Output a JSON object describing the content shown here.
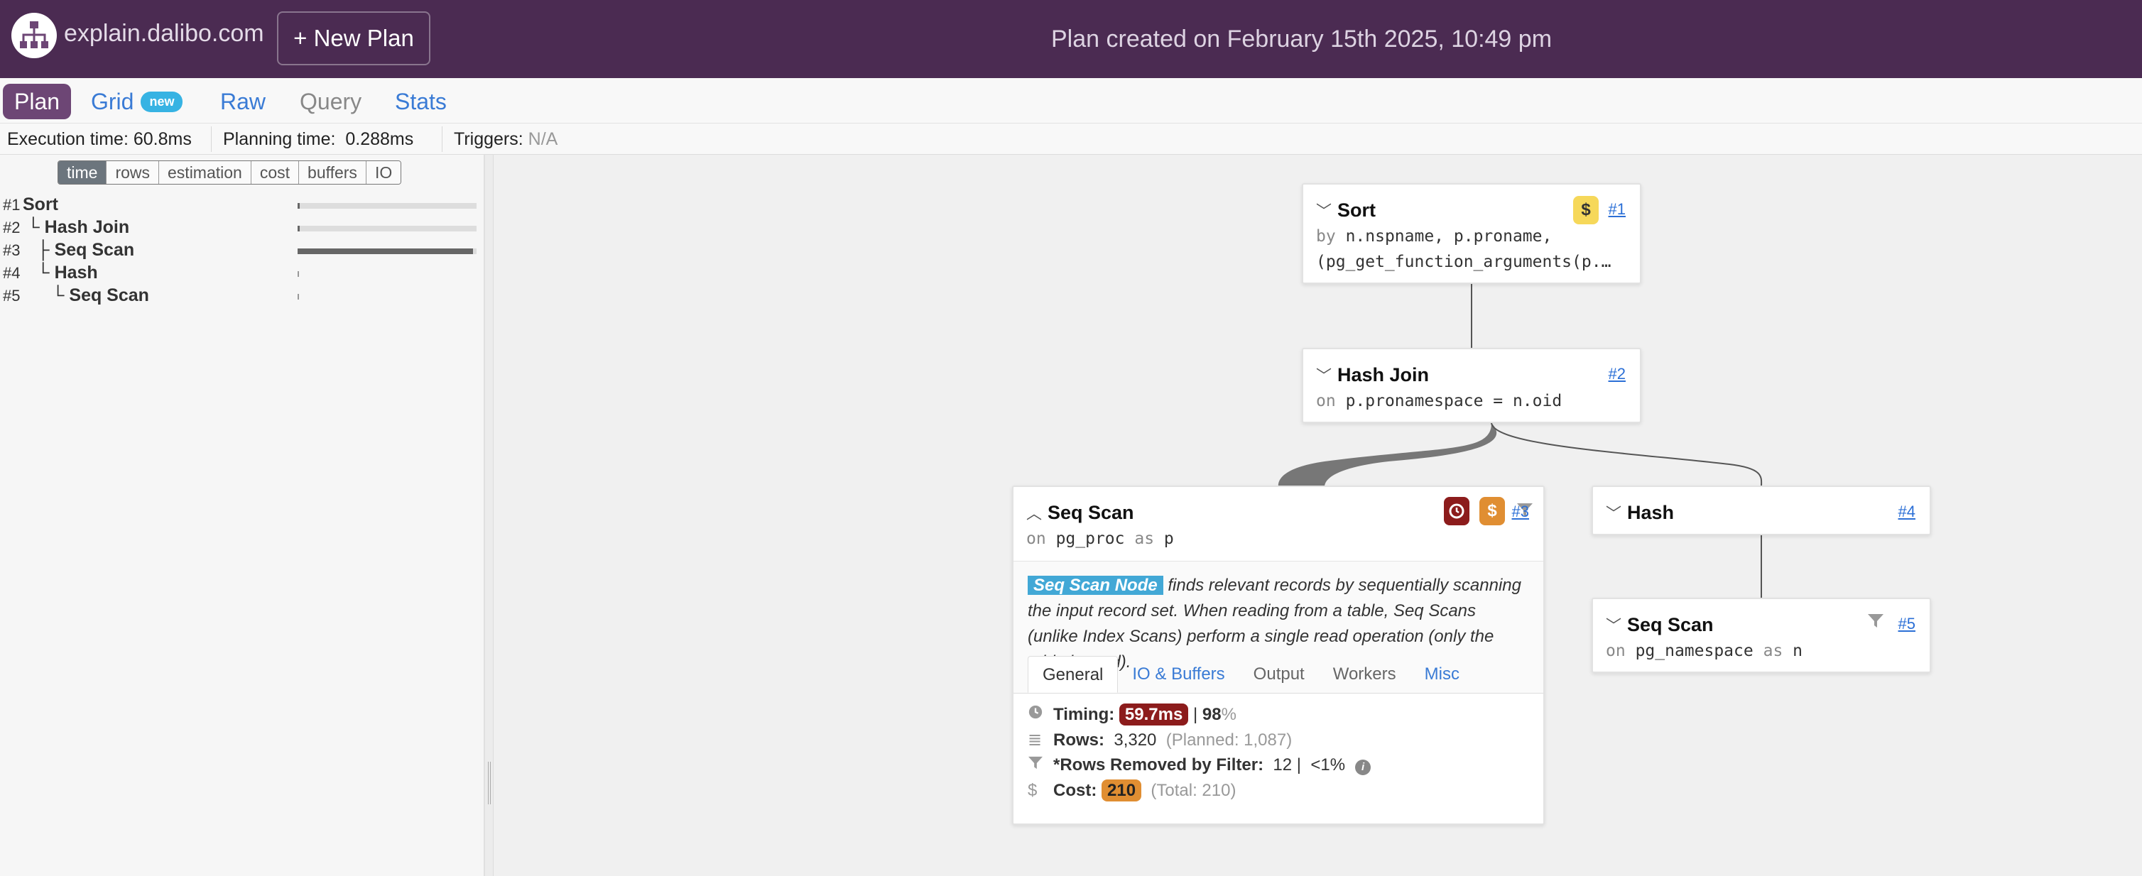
{
  "header": {
    "site_name": "explain.dalibo.com",
    "new_plan_label": "+ New Plan",
    "plan_created": "Plan created on February 15th 2025, 10:49 pm"
  },
  "nav": {
    "plan": "Plan",
    "grid": "Grid",
    "grid_badge": "new",
    "raw": "Raw",
    "query": "Query",
    "stats": "Stats"
  },
  "stats": {
    "execution_label": "Execution time:",
    "execution_value": "60.8ms",
    "planning_label": "Planning time:",
    "planning_value": "0.288ms",
    "triggers_label": "Triggers:",
    "triggers_value": "N/A"
  },
  "metrics": [
    "time",
    "rows",
    "estimation",
    "cost",
    "buffers",
    "IO"
  ],
  "metric_active": "time",
  "tree": [
    {
      "num": "#1",
      "label": "Sort",
      "prefix": "",
      "time_fraction": 0.01
    },
    {
      "num": "#2",
      "label": "Hash Join",
      "prefix": "└ ",
      "time_fraction": 0.01
    },
    {
      "num": "#3",
      "label": "Seq Scan",
      "prefix": "  ├ ",
      "time_fraction": 0.98
    },
    {
      "num": "#4",
      "label": "Hash",
      "prefix": "  └ ",
      "time_fraction": 0.0
    },
    {
      "num": "#5",
      "label": "Seq Scan",
      "prefix": "     └ ",
      "time_fraction": 0.0
    }
  ],
  "nodes": {
    "sort": {
      "title": "Sort",
      "link": "#1",
      "sub_kw": "by",
      "sub_line1": "n.nspname, p.proname,",
      "sub_line2": "(pg_get_function_arguments(p.…"
    },
    "hashjoin": {
      "title": "Hash Join",
      "link": "#2",
      "sub_kw": "on",
      "sub": "p.pronamespace = n.oid"
    },
    "seqscan3": {
      "title": "Seq Scan",
      "link": "#3",
      "sub_kw": "on",
      "rel": "pg_proc",
      "as_kw": "as",
      "alias": "p",
      "desc_pill": "Seq Scan Node",
      "desc_text": "finds relevant records by sequentially scanning the input record set. When reading from a table, Seq Scans (unlike Index Scans) perform a single read operation (only the table is read).",
      "tabs": [
        "General",
        "IO & Buffers",
        "Output",
        "Workers",
        "Misc"
      ],
      "timing_label": "Timing:",
      "timing_value": "59.7ms",
      "timing_sep": "|",
      "timing_pct": "98",
      "timing_pct_unit": "%",
      "rows_label": "Rows:",
      "rows_value": "3,320",
      "rows_planned": "(Planned: 1,087)",
      "removed_label": "*Rows Removed by Filter:",
      "removed_value": "12",
      "removed_sep": "|",
      "removed_pct": "<1%",
      "cost_label": "Cost:",
      "cost_value": "210",
      "cost_total": "(Total: 210)"
    },
    "hash": {
      "title": "Hash",
      "link": "#4"
    },
    "seqscan5": {
      "title": "Seq Scan",
      "link": "#5",
      "sub_kw": "on",
      "rel": "pg_namespace",
      "as_kw": "as",
      "alias": "n"
    }
  },
  "colors": {
    "header_bg": "#4b2b52",
    "plan_tab_bg": "#6d4675",
    "link": "#3a7bd5",
    "clock_badge": "#8c1c1c",
    "cost_badge": "#e08e32",
    "sort_cost_badge": "#f6d85a",
    "desc_pill": "#42a8d6"
  },
  "icons": {
    "logo": "hierarchy-logo-icon",
    "chevron_down": "chevron-down-icon",
    "chevron_up": "chevron-up-icon",
    "clock": "clock-icon",
    "dollar": "dollar-icon",
    "filter": "filter-icon",
    "rows": "list-icon",
    "info": "info-icon"
  }
}
